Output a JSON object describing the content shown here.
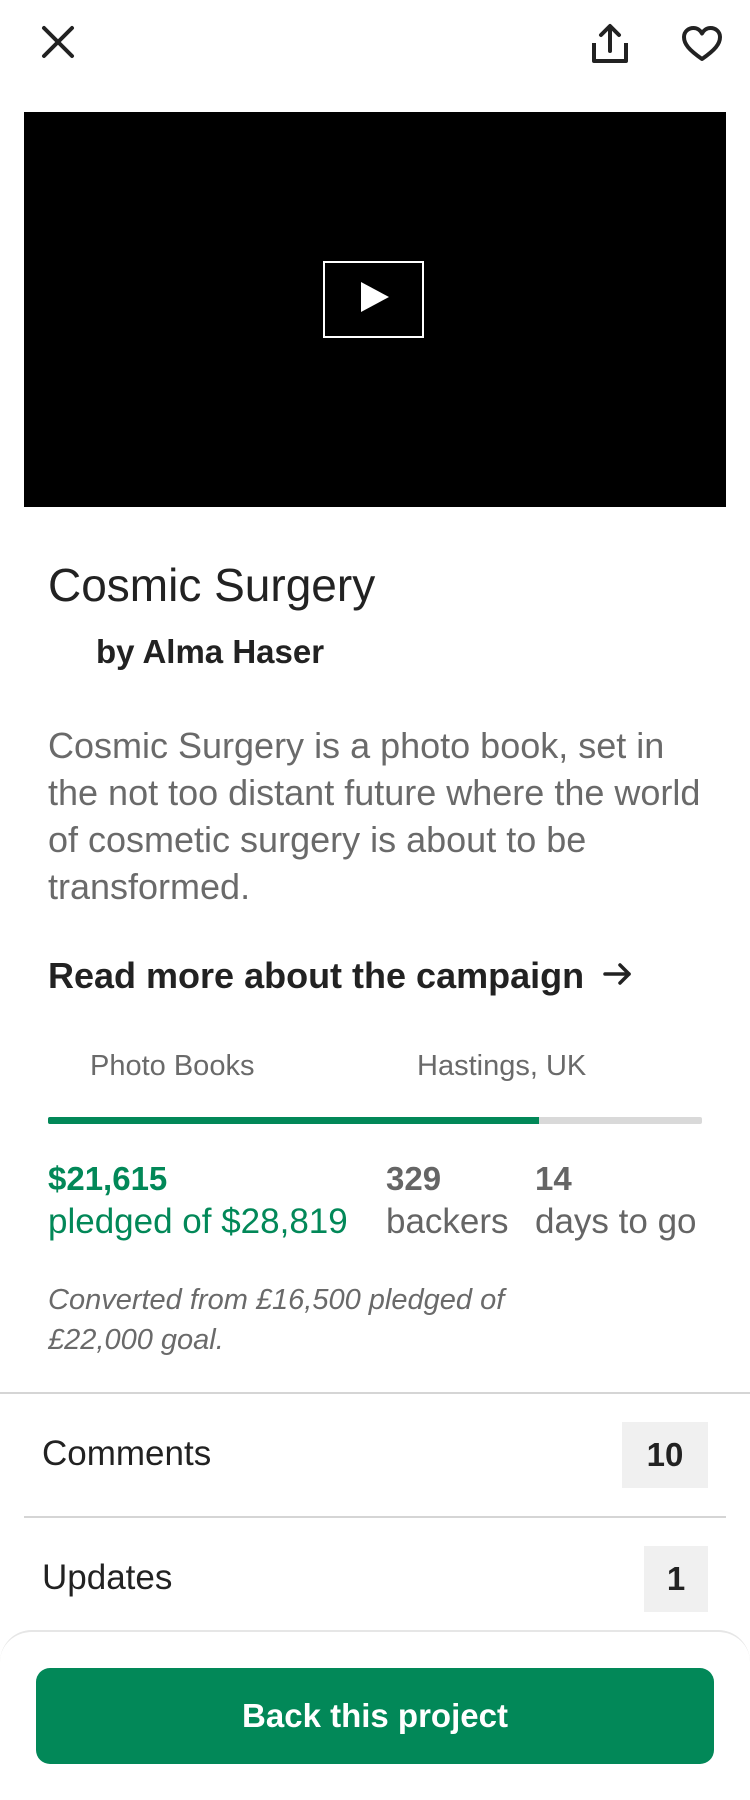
{
  "icons": {
    "close": "close-icon",
    "share": "share-icon",
    "favorite": "heart-icon",
    "play": "play-icon",
    "arrow": "arrow-right-icon"
  },
  "project": {
    "title": "Cosmic Surgery",
    "creator": "by Alma Haser",
    "blurb": "Cosmic Surgery is a photo book, set in the not too distant future where the world of cosmetic surgery is about to be transformed.",
    "read_more": "Read more about the campaign",
    "category": "Photo Books",
    "location": "Hastings, UK"
  },
  "funding": {
    "progress_fraction": 0.75,
    "pledged_amount": "$21,615",
    "pledged_label": "pledged of $28,819",
    "backers_count": "329",
    "backers_label": "backers",
    "days_count": "14",
    "days_label": "days to go",
    "converted_note": "Converted from £16,500 pledged of £22,000 goal."
  },
  "sections": {
    "comments_label": "Comments",
    "comments_count": "10",
    "updates_label": "Updates",
    "updates_count": "1"
  },
  "cta": {
    "label": "Back this project"
  },
  "colors": {
    "accent": "#028858",
    "text": "#222222",
    "muted": "#6a6a6a"
  }
}
